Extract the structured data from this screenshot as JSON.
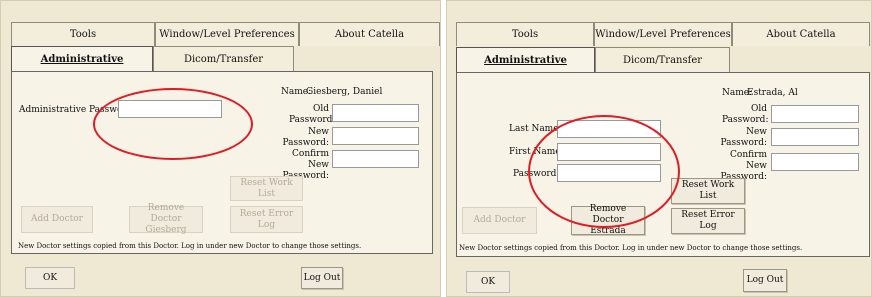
{
  "left": {
    "top_tabs": [
      "Tools",
      "Window/Level Preferences",
      "About Catella"
    ],
    "sub_tabs": [
      "Administrative",
      "Dicom/Transfer"
    ],
    "name_label": "Name:",
    "name_value": "Giesberg, Daniel",
    "admin_password_label": "Administrative Password:",
    "old_password_label": "Old Password:",
    "new_password_label": "New Password:",
    "confirm_password_label": "Confirm New Password:",
    "reset_work_list": "Reset Work List",
    "add_doctor": "Add Doctor",
    "remove_doctor": "Remove Doctor Giesberg",
    "reset_error_log": "Reset Error Log",
    "note": "New Doctor settings copied from this Doctor.   Log in under new Doctor to change those settings.",
    "ok": "OK",
    "log_out": "Log Out"
  },
  "right": {
    "top_tabs": [
      "Tools",
      "Window/Level Preferences",
      "About Catella"
    ],
    "sub_tabs": [
      "Administrative",
      "Dicom/Transfer"
    ],
    "name_label": "Name:",
    "name_value": "Estrada, Al",
    "old_password_label": "Old Password:",
    "new_password_label": "New Password:",
    "confirm_password_label": "Confirm New Password:",
    "last_name_label": "Last Name:",
    "first_name_label": "First Name:",
    "password_label": "Password:",
    "reset_work_list": "Reset Work List",
    "add_doctor": "Add Doctor",
    "remove_doctor": "Remove Doctor Estrada",
    "reset_error_log": "Reset Error Log",
    "note": "New Doctor settings copied from this Doctor.   Log in under new Doctor to change those settings.",
    "ok": "OK",
    "log_out": "Log Out"
  }
}
